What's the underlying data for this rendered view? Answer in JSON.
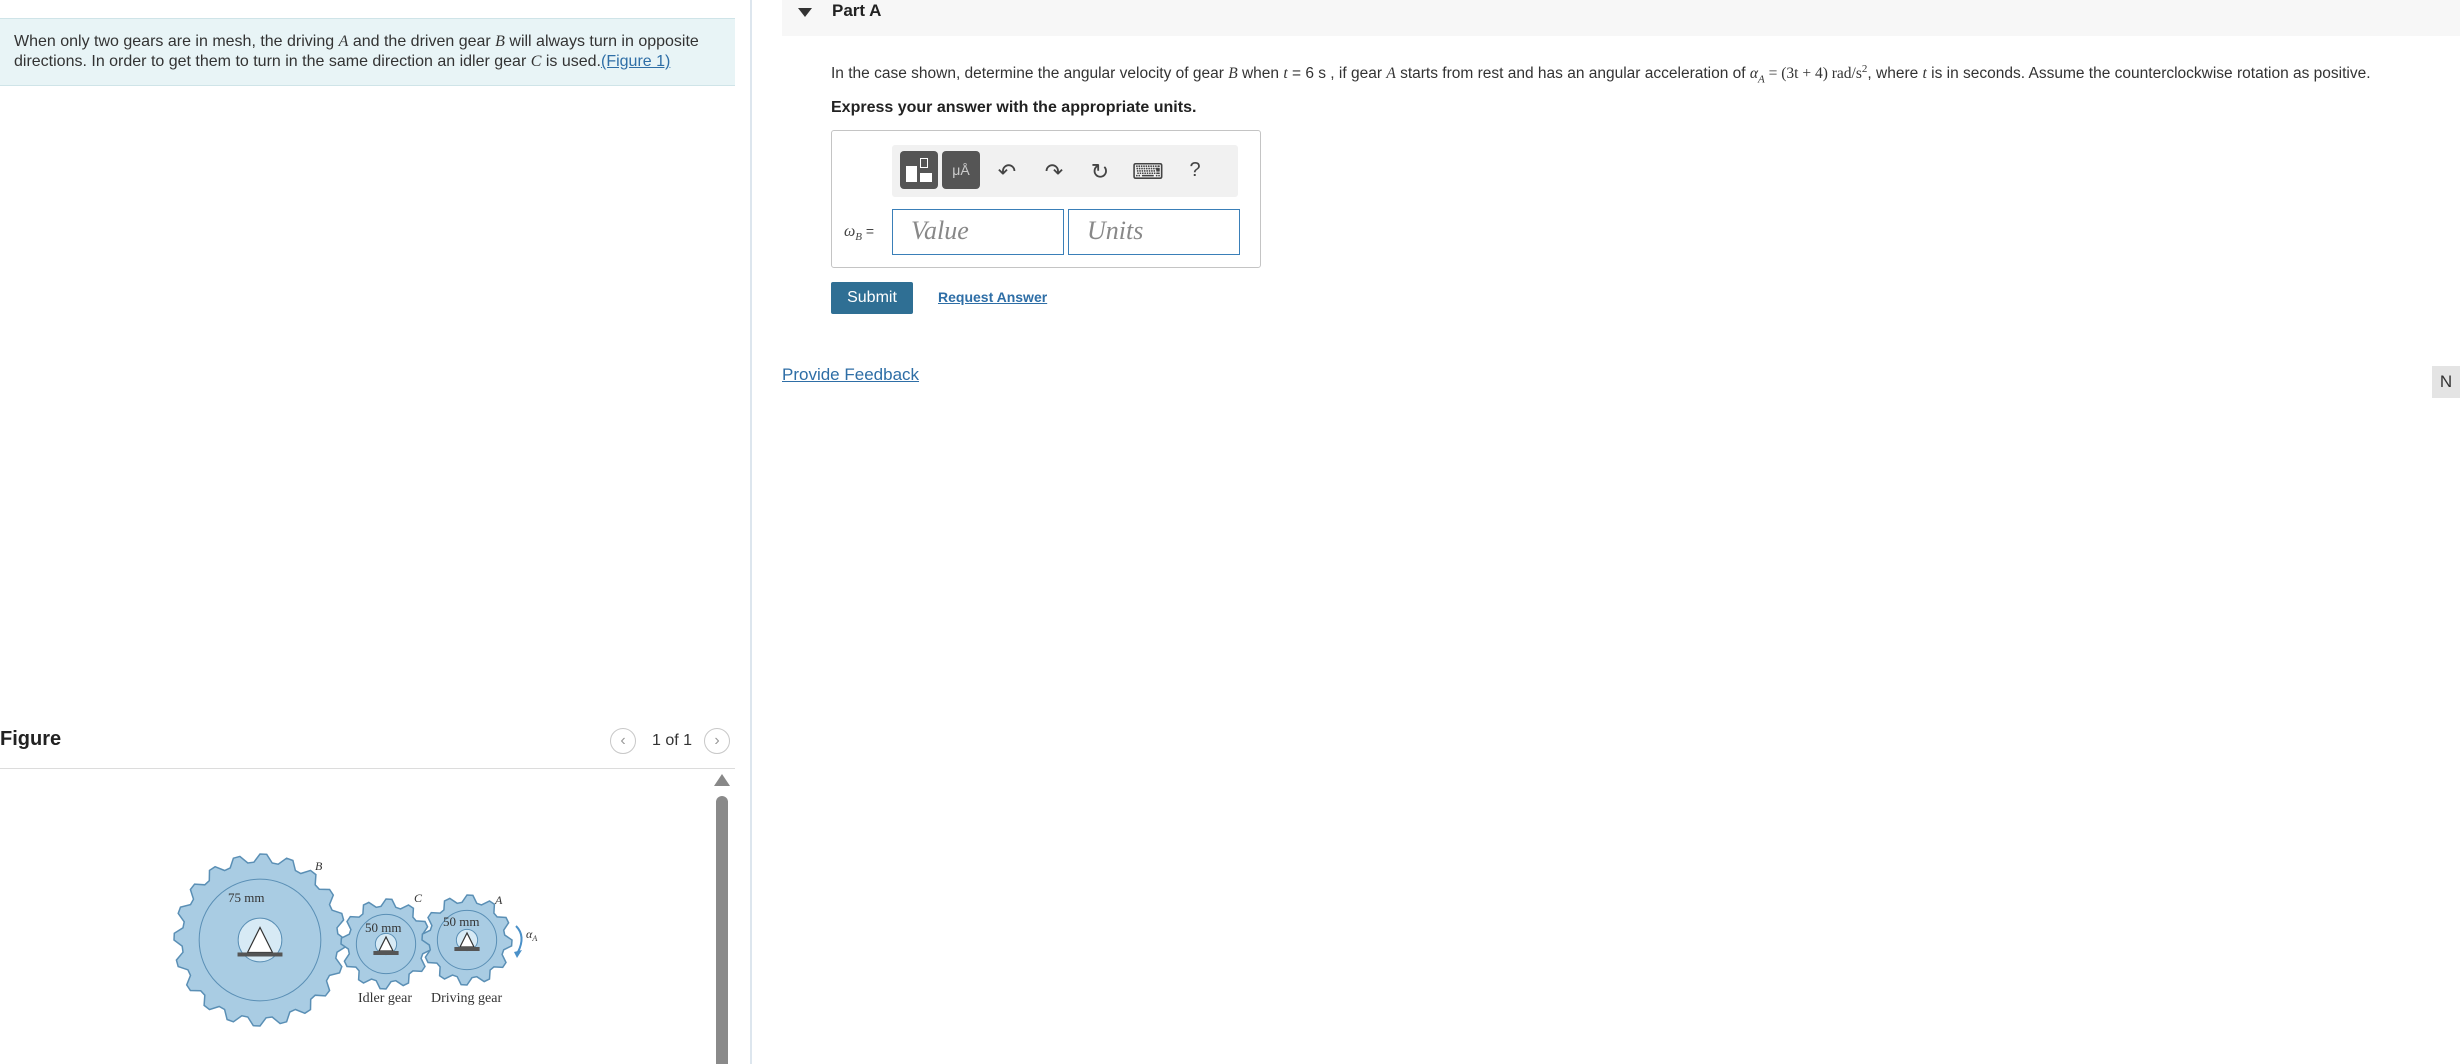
{
  "problem": {
    "text_1": "When only two gears are in mesh, the driving ",
    "var_a": "A",
    "text_2": " and the driven gear ",
    "var_b": "B",
    "text_3": " will always turn in opposite directions. In order to get them to turn in the same direction an idler gear ",
    "var_c": "C",
    "text_4": " is used.",
    "figure_link": "(Figure 1)"
  },
  "figure_panel": {
    "title": "Figure",
    "counter": "1 of 1",
    "prev_icon": "chevron-left-icon",
    "next_icon": "chevron-right-icon"
  },
  "figure": {
    "gear_b_label": "B",
    "gear_c_label": "C",
    "gear_a_label": "A",
    "radius_b": "75 mm",
    "radius_c": "50 mm",
    "radius_a": "50 mm",
    "idler_caption": "Idler gear",
    "driving_caption": "Driving gear",
    "alpha_label": "α",
    "alpha_sub": "A",
    "gear_color": "#a9cce3",
    "gear_stroke": "#5a8fb5"
  },
  "part": {
    "title": "Part A",
    "question_1": "In the case shown, determine the angular velocity of gear ",
    "q_var_b": "B",
    "question_2": " when ",
    "q_var_t": "t",
    "question_3": " = 6 s , if gear ",
    "q_var_a": "A",
    "question_4": " starts from rest and has an angular acceleration of ",
    "q_alpha": "α",
    "q_alpha_sub": "A",
    "q_formula": " = (3t + 4) rad/s",
    "q_exp": "2",
    "question_5": ", where ",
    "q_var_t2": "t",
    "question_6": " is in seconds. Assume the counterclockwise rotation as positive.",
    "instructions": "Express your answer with the appropriate units."
  },
  "answer": {
    "omega": "ω",
    "omega_sub": "B",
    "equals": " =",
    "value_placeholder": "Value",
    "units_placeholder": "Units"
  },
  "toolbar": {
    "templates_icon": "templates-icon",
    "units_icon": "mu-a-units-icon",
    "units_label": "μÅ",
    "undo": "↶",
    "redo": "↷",
    "reset": "↻",
    "keyboard": "⌨",
    "help": "?"
  },
  "actions": {
    "submit": "Submit",
    "request_answer": "Request Answer",
    "provide_feedback": "Provide Feedback",
    "next_tab": "N"
  }
}
